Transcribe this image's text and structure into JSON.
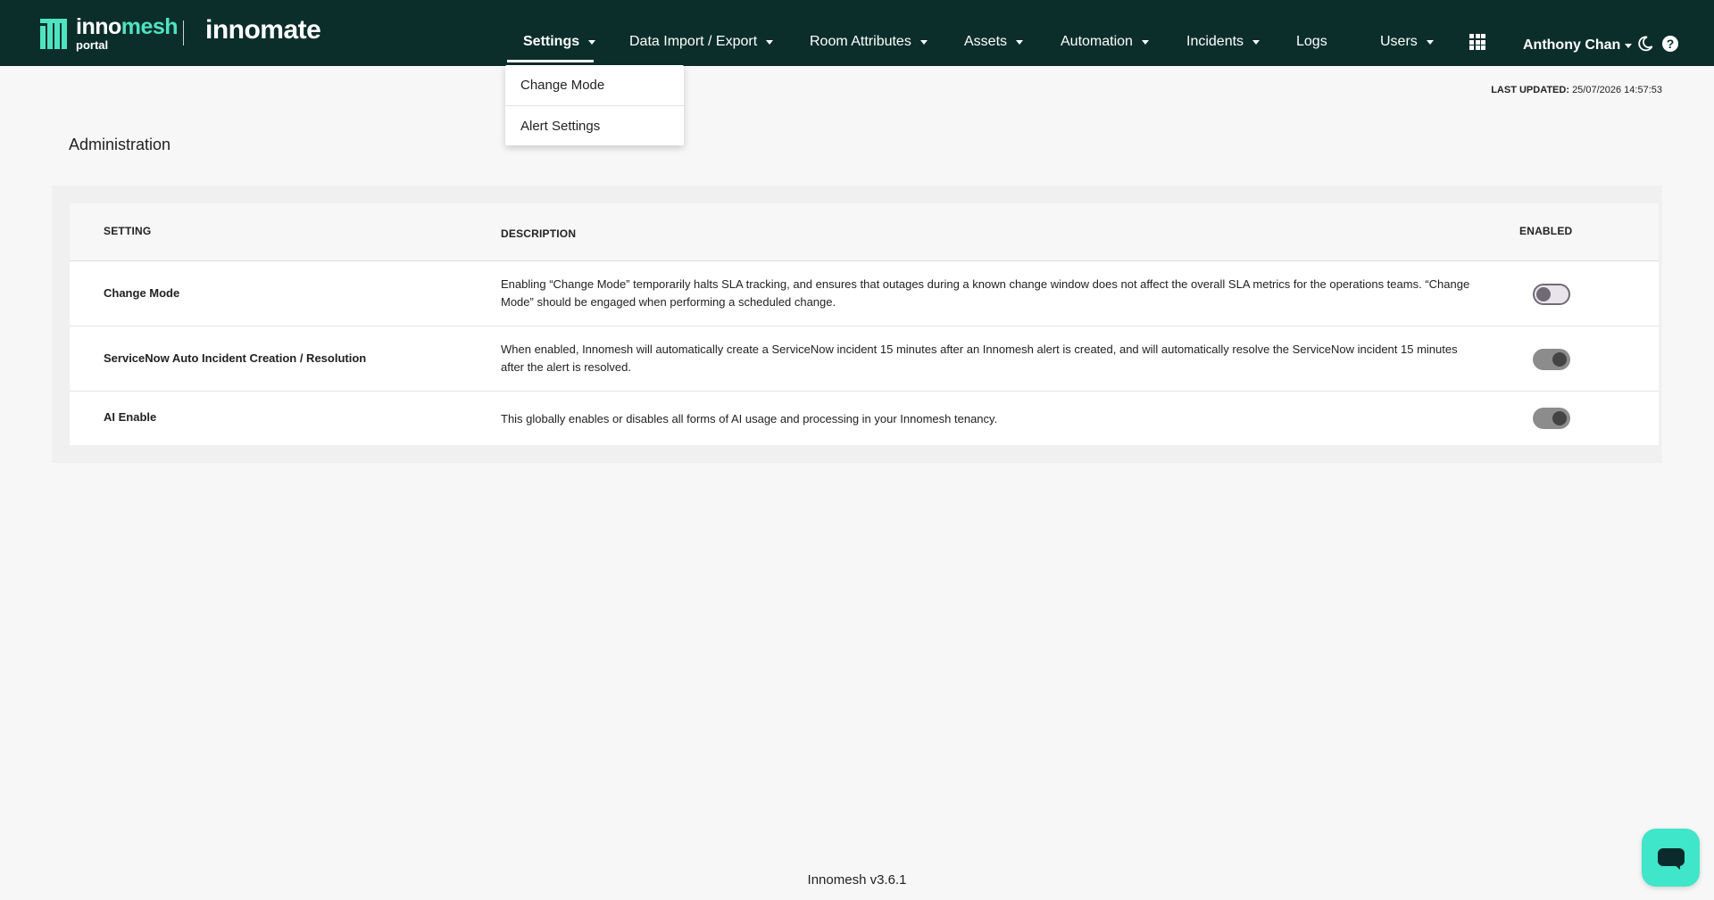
{
  "header": {
    "logo": {
      "part1": "inno",
      "part2": "mesh",
      "sub": "portal"
    },
    "brand2": "innomate",
    "nav": [
      {
        "label": "Settings",
        "active": true,
        "caret": true
      },
      {
        "label": "Data Import / Export",
        "caret": true
      },
      {
        "label": "Room Attributes",
        "caret": true
      },
      {
        "label": "Assets",
        "caret": true
      },
      {
        "label": "Automation",
        "caret": true
      },
      {
        "label": "Incidents",
        "caret": true
      },
      {
        "label": "Logs",
        "caret": false
      },
      {
        "label": "Users",
        "caret": true
      }
    ],
    "user_name": "Anthony Chan",
    "help_glyph": "?"
  },
  "dropdown": {
    "items": [
      "Change Mode",
      "Alert Settings"
    ]
  },
  "last_updated": {
    "label": "LAST UPDATED:",
    "value": "25/07/2026 14:57:53"
  },
  "page_title": "Administration",
  "table": {
    "headers": {
      "setting": "SETTING",
      "description": "DESCRIPTION",
      "enabled": "ENABLED"
    },
    "rows": [
      {
        "setting": "Change Mode",
        "description": "Enabling “Change Mode” temporarily halts SLA tracking, and ensures that outages during a known change window does not affect the overall SLA metrics for the operations teams. “Change Mode” should be engaged when performing a scheduled change.",
        "enabled": false
      },
      {
        "setting": "ServiceNow Auto Incident Creation / Resolution",
        "description": "When enabled, Innomesh will automatically create a ServiceNow incident 15 minutes after an Innomesh alert is created, and will automatically resolve the ServiceNow incident 15 minutes after the alert is resolved.",
        "enabled": true
      },
      {
        "setting": "AI Enable",
        "description": "This globally enables or disables all forms of AI usage and processing in your Innomesh tenancy.",
        "enabled": true
      }
    ]
  },
  "footer": "Innomesh v3.6.1",
  "colors": {
    "header_bg": "#0c2e2b",
    "accent": "#4fe3c1",
    "chat_button": "#3fe6c9"
  },
  "icons": [
    "apps-grid-icon",
    "moon-icon",
    "help-icon",
    "chat-icon"
  ]
}
